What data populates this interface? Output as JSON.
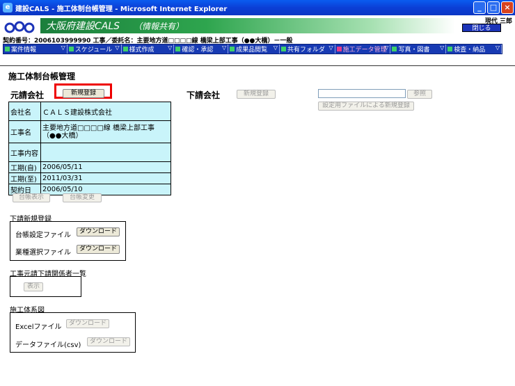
{
  "window": {
    "title": "建設CALS - 施工体制台帳管理 - Microsoft Internet Explorer",
    "icon": "ie-icon",
    "buttons": {
      "minimize": "_",
      "maximize": "□",
      "close": "×"
    }
  },
  "header": {
    "banner_title": "大阪府建設CALS",
    "banner_sub": "（情報共有）",
    "user_name": "現代 三郎",
    "logout_label": "閉じる"
  },
  "contract_line": "契約番号：2006103999990 工事／委託名：主要地方道□□□□線 橋梁上部工事（●●大橋）－一般",
  "menu": [
    {
      "label": "案件情報",
      "active": false,
      "width": 92
    },
    {
      "label": "スケジュール",
      "active": false,
      "width": 78
    },
    {
      "label": "様式作成",
      "active": false,
      "width": 76
    },
    {
      "label": "確認・承認",
      "active": false,
      "width": 78
    },
    {
      "label": "成果品閲覧",
      "active": false,
      "width": 74
    },
    {
      "label": "共有フォルダ",
      "active": false,
      "width": 80
    },
    {
      "label": "施工データ管理",
      "active": true,
      "width": 80
    },
    {
      "label": "写真・図書",
      "active": false,
      "width": 80
    },
    {
      "label": "検査・納品",
      "active": false,
      "width": 80
    }
  ],
  "page": {
    "title": "施工体制台帳管理",
    "prime": {
      "label": "元請会社",
      "new_button": "新規登録",
      "rows": [
        {
          "key": "会社名",
          "value": "ＣＡＬＳ建設株式会社"
        },
        {
          "key": "工事名",
          "value": "主要地方道□□□□線 橋梁上部工事\n（●●大橋）"
        },
        {
          "key": "工事内容",
          "value": ""
        },
        {
          "key": "工期(自)",
          "value": "2006/05/11"
        },
        {
          "key": "工期(至)",
          "value": "2011/03/31"
        },
        {
          "key": "契約日",
          "value": "2006/05/10"
        }
      ],
      "view_button": "台帳表示",
      "change_button": "台帳変更"
    },
    "sub": {
      "label": "下請会社",
      "new_button": "新規登録",
      "browse_button": "参照",
      "file_register_button": "設定用ファイルによる新規登録"
    },
    "subreg": {
      "title": "下請新規登録",
      "ledger_label": "台帳設定ファイル",
      "trade_label": "業種選択ファイル",
      "download": "ダウンロード"
    },
    "related": {
      "title": "工事元請下請関係者一覧",
      "show_button": "表示"
    },
    "diagram": {
      "title": "施工体系図",
      "excel_label": "Excelファイル",
      "csv_label": "データファイル(csv)",
      "download": "ダウンロード"
    }
  }
}
